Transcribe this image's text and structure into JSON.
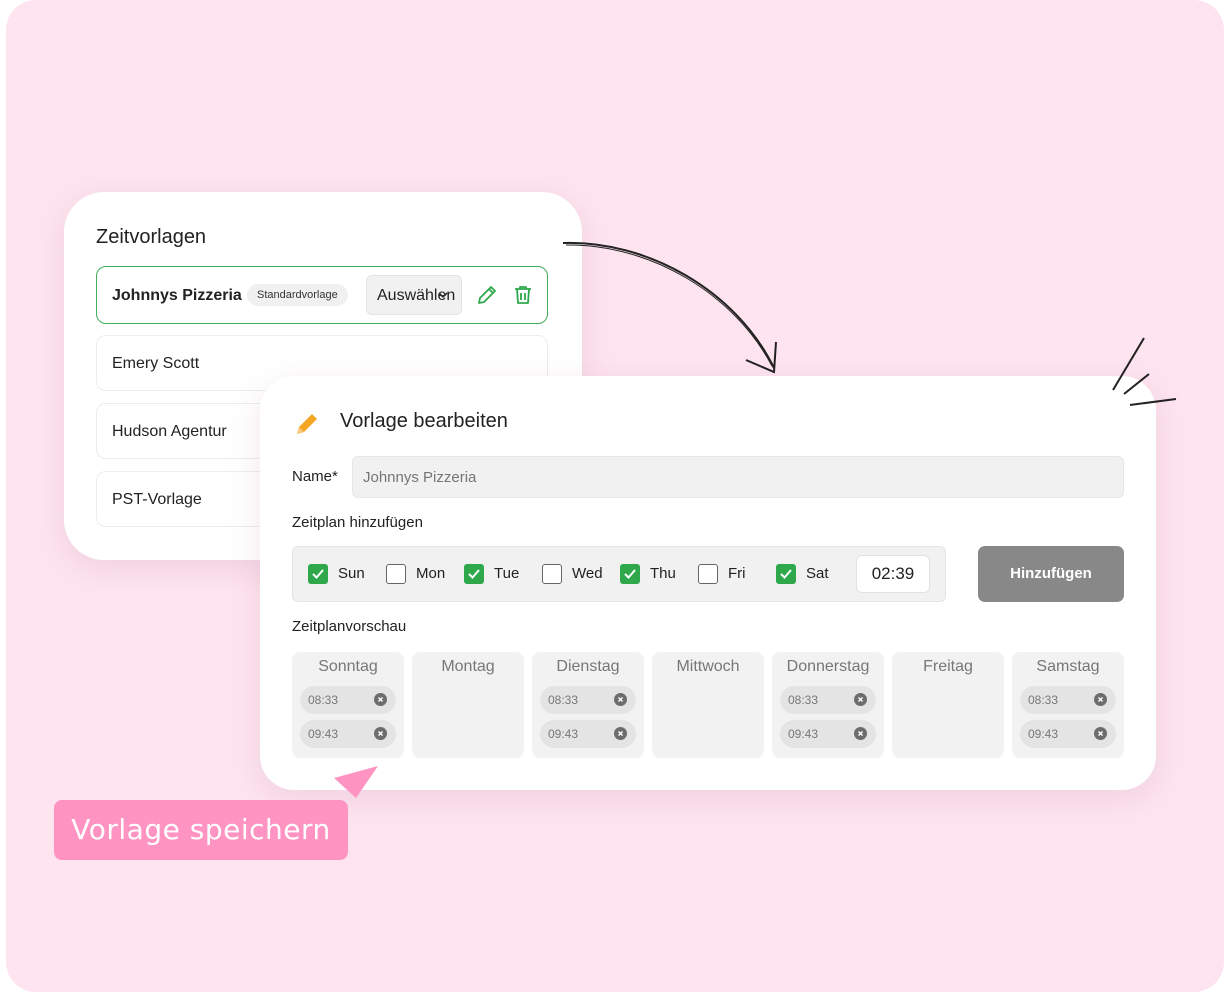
{
  "templates": {
    "title": "Zeitvorlagen",
    "items": [
      {
        "name": "Johnnys Pizzeria",
        "badge": "Standardvorlage",
        "select_label": "Auswählen"
      },
      {
        "name": "Emery Scott"
      },
      {
        "name": "Hudson Agentur"
      },
      {
        "name": "PST-Vorlage"
      }
    ]
  },
  "editor": {
    "title": "Vorlage bearbeiten",
    "name_label": "Name*",
    "name_placeholder": "Johnnys Pizzeria",
    "schedule_label": "Zeitplan hinzufügen",
    "days": [
      {
        "label": "Sun",
        "checked": true
      },
      {
        "label": "Mon",
        "checked": false
      },
      {
        "label": "Tue",
        "checked": true
      },
      {
        "label": "Wed",
        "checked": false
      },
      {
        "label": "Thu",
        "checked": true
      },
      {
        "label": "Fri",
        "checked": false
      },
      {
        "label": "Sat",
        "checked": true
      }
    ],
    "time": "02:39",
    "add_button": "Hinzufügen",
    "preview_label": "Zeitplanvorschau",
    "preview": [
      {
        "day": "Sonntag",
        "times": [
          "08:33",
          "09:43"
        ]
      },
      {
        "day": "Montag",
        "times": []
      },
      {
        "day": "Dienstag",
        "times": [
          "08:33",
          "09:43"
        ]
      },
      {
        "day": "Mittwoch",
        "times": []
      },
      {
        "day": "Donnerstag",
        "times": [
          "08:33",
          "09:43"
        ]
      },
      {
        "day": "Freitag",
        "times": []
      },
      {
        "day": "Samstag",
        "times": [
          "08:33",
          "09:43"
        ]
      }
    ]
  },
  "callout": {
    "label": "Vorlage speichern"
  },
  "colors": {
    "background": "#fde4ef",
    "accent_green": "#2ea84a",
    "pink": "#ff93c2",
    "button_gray": "#888888",
    "pencil_orange": "#f5a623"
  }
}
